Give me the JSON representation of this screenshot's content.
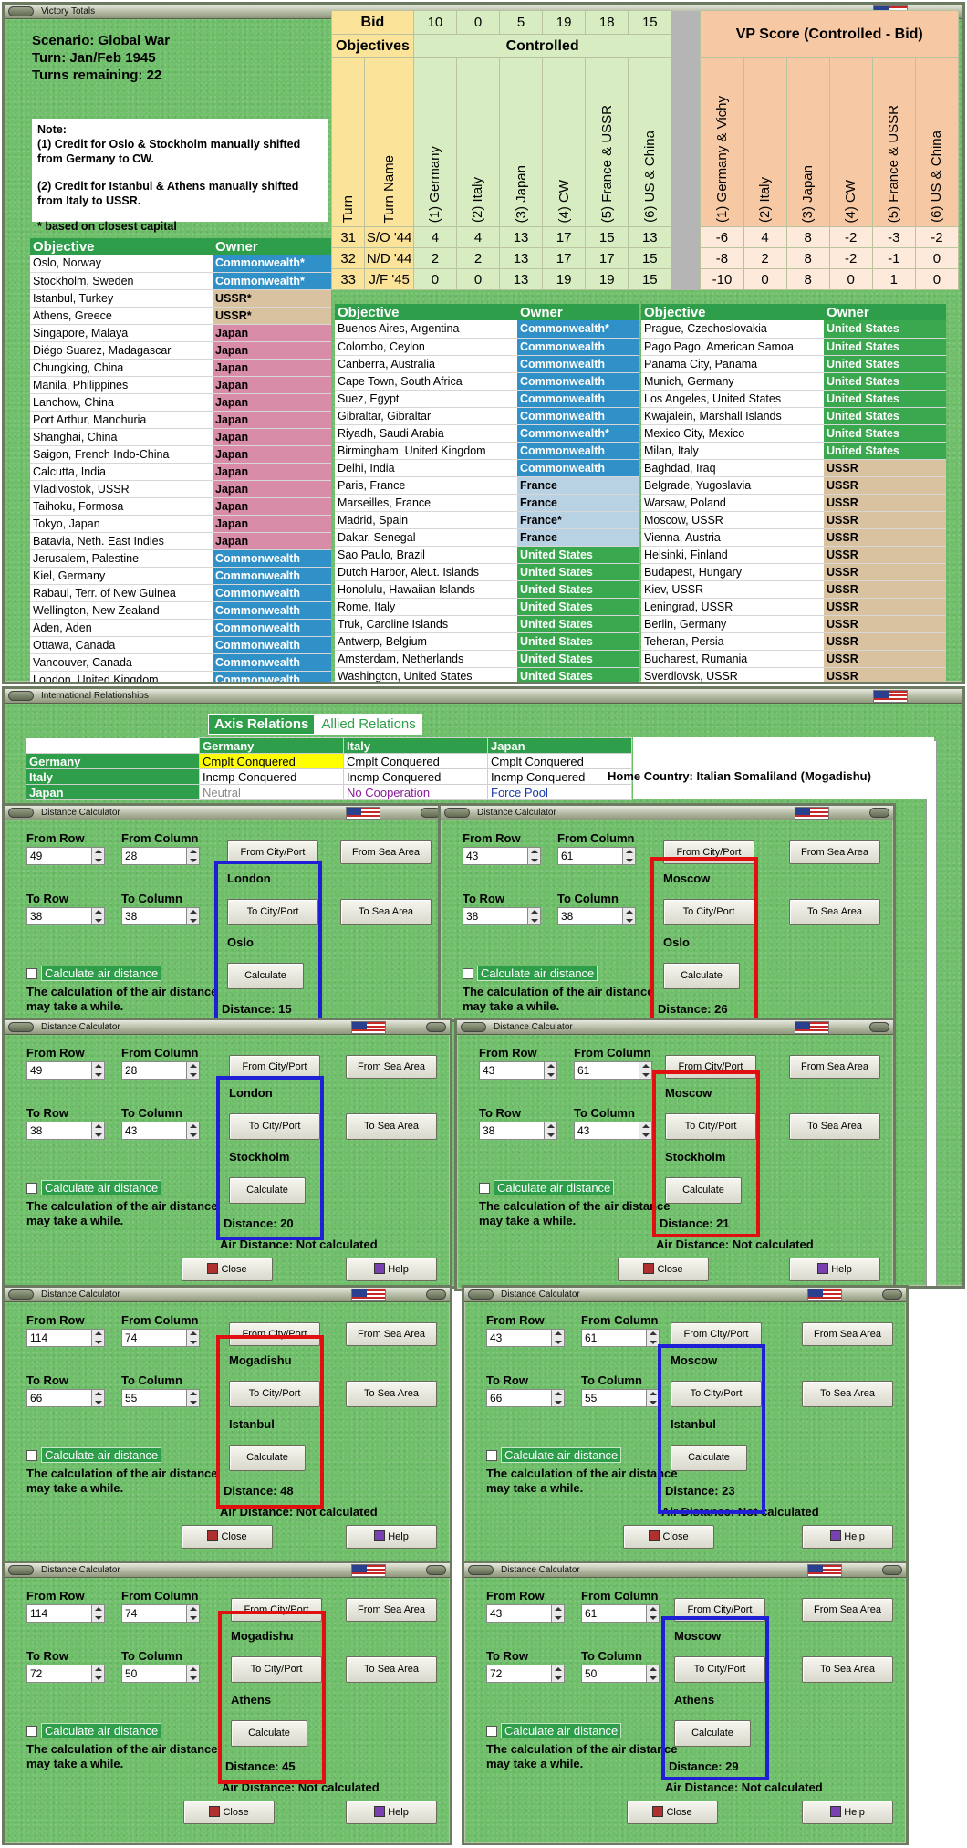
{
  "victory": {
    "title": "Victory Totals",
    "scenario": "Scenario: Global War",
    "turn": "Turn: Jan/Feb 1945",
    "turns_remaining": "Turns remaining: 22",
    "note_title": "Note:",
    "note1": "(1) Credit for Oslo & Stockholm manually shifted from Germany to CW.",
    "note2": "(2) Credit for Istanbul & Athens manually shifted from Italy to USSR.",
    "footnote": "* based on closest capital",
    "header_objective": "Objective",
    "header_owner": "Owner",
    "bid_label": "Bid",
    "bid_values": [
      "10",
      "0",
      "5",
      "19",
      "18",
      "15"
    ],
    "objectives_label": "Objectives",
    "controlled_label": "Controlled",
    "vp_label": "VP Score (Controlled - Bid)",
    "turn_col": "Turn",
    "turnname_col": "Turn Name",
    "powers": [
      "(1) Germany",
      "(2) Italy",
      "(3) Japan",
      "(4) CW",
      "(5) France & USSR",
      "(6) US & China"
    ],
    "vp_powers": [
      "(1) Germany & Vichy",
      "(2) Italy",
      "(3) Japan",
      "(4) CW",
      "(5) France & USSR",
      "(6) US & China"
    ],
    "rows": [
      {
        "turn": "31",
        "name": "S/O '44",
        "controlled": [
          "4",
          "4",
          "13",
          "17",
          "15",
          "13"
        ],
        "vp": [
          "-6",
          "4",
          "8",
          "-2",
          "-3",
          "-2"
        ]
      },
      {
        "turn": "32",
        "name": "N/D '44",
        "controlled": [
          "2",
          "2",
          "13",
          "17",
          "17",
          "15"
        ],
        "vp": [
          "-8",
          "2",
          "8",
          "-2",
          "-1",
          "0"
        ]
      },
      {
        "turn": "33",
        "name": "J/F '45",
        "controlled": [
          "0",
          "0",
          "13",
          "19",
          "19",
          "15"
        ],
        "vp": [
          "-10",
          "0",
          "8",
          "0",
          "1",
          "0"
        ]
      }
    ],
    "col1": [
      {
        "name": "Oslo, Norway",
        "owner": "Commonwealth*",
        "cls": "Commonwealth"
      },
      {
        "name": "Stockholm, Sweden",
        "owner": "Commonwealth*",
        "cls": "Commonwealth"
      },
      {
        "name": "Istanbul, Turkey",
        "owner": "USSR*",
        "cls": "USSR"
      },
      {
        "name": "Athens, Greece",
        "owner": "USSR*",
        "cls": "USSR"
      },
      {
        "name": "Singapore, Malaya",
        "owner": "Japan",
        "cls": "Japan"
      },
      {
        "name": "Diégo Suarez, Madagascar",
        "owner": "Japan",
        "cls": "Japan"
      },
      {
        "name": "Chungking, China",
        "owner": "Japan",
        "cls": "Japan"
      },
      {
        "name": "Manila, Philippines",
        "owner": "Japan",
        "cls": "Japan"
      },
      {
        "name": "Lanchow, China",
        "owner": "Japan",
        "cls": "Japan"
      },
      {
        "name": "Port Arthur, Manchuria",
        "owner": "Japan",
        "cls": "Japan"
      },
      {
        "name": "Shanghai, China",
        "owner": "Japan",
        "cls": "Japan"
      },
      {
        "name": "Saigon, French Indo-China",
        "owner": "Japan",
        "cls": "Japan"
      },
      {
        "name": "Calcutta, India",
        "owner": "Japan",
        "cls": "Japan"
      },
      {
        "name": "Vladivostok, USSR",
        "owner": "Japan",
        "cls": "Japan"
      },
      {
        "name": "Taihoku, Formosa",
        "owner": "Japan",
        "cls": "Japan"
      },
      {
        "name": "Tokyo, Japan",
        "owner": "Japan",
        "cls": "Japan"
      },
      {
        "name": "Batavia, Neth. East Indies",
        "owner": "Japan",
        "cls": "Japan"
      },
      {
        "name": "Jerusalem, Palestine",
        "owner": "Commonwealth",
        "cls": "Commonwealth"
      },
      {
        "name": "Kiel, Germany",
        "owner": "Commonwealth",
        "cls": "Commonwealth"
      },
      {
        "name": "Rabaul, Terr. of New Guinea",
        "owner": "Commonwealth",
        "cls": "Commonwealth"
      },
      {
        "name": "Wellington, New Zealand",
        "owner": "Commonwealth",
        "cls": "Commonwealth"
      },
      {
        "name": "Aden, Aden",
        "owner": "Commonwealth",
        "cls": "Commonwealth"
      },
      {
        "name": "Ottawa, Canada",
        "owner": "Commonwealth",
        "cls": "Commonwealth"
      },
      {
        "name": "Vancouver, Canada",
        "owner": "Commonwealth",
        "cls": "Commonwealth"
      },
      {
        "name": "London, United Kingdom",
        "owner": "Commonwealth",
        "cls": "Commonwealth"
      }
    ],
    "col2": [
      {
        "name": "Buenos Aires, Argentina",
        "owner": "Commonwealth*",
        "cls": "Commonwealth"
      },
      {
        "name": "Colombo, Ceylon",
        "owner": "Commonwealth",
        "cls": "Commonwealth"
      },
      {
        "name": "Canberra, Australia",
        "owner": "Commonwealth",
        "cls": "Commonwealth"
      },
      {
        "name": "Cape Town, South Africa",
        "owner": "Commonwealth",
        "cls": "Commonwealth"
      },
      {
        "name": "Suez, Egypt",
        "owner": "Commonwealth",
        "cls": "Commonwealth"
      },
      {
        "name": "Gibraltar, Gibraltar",
        "owner": "Commonwealth",
        "cls": "Commonwealth"
      },
      {
        "name": "Riyadh, Saudi Arabia",
        "owner": "Commonwealth*",
        "cls": "Commonwealth"
      },
      {
        "name": "Birmingham, United Kingdom",
        "owner": "Commonwealth",
        "cls": "Commonwealth"
      },
      {
        "name": "Delhi, India",
        "owner": "Commonwealth",
        "cls": "Commonwealth"
      },
      {
        "name": "Paris, France",
        "owner": "France",
        "cls": "France"
      },
      {
        "name": "Marseilles, France",
        "owner": "France",
        "cls": "France"
      },
      {
        "name": "Madrid, Spain",
        "owner": "France*",
        "cls": "France"
      },
      {
        "name": "Dakar, Senegal",
        "owner": "France",
        "cls": "France"
      },
      {
        "name": "Sao Paulo, Brazil",
        "owner": "United States",
        "cls": "US"
      },
      {
        "name": "Dutch Harbor, Aleut. Islands",
        "owner": "United States",
        "cls": "US"
      },
      {
        "name": "Honolulu, Hawaiian Islands",
        "owner": "United States",
        "cls": "US"
      },
      {
        "name": "Rome, Italy",
        "owner": "United States",
        "cls": "US"
      },
      {
        "name": "Truk, Caroline Islands",
        "owner": "United States",
        "cls": "US"
      },
      {
        "name": "Antwerp, Belgium",
        "owner": "United States",
        "cls": "US"
      },
      {
        "name": "Amsterdam, Netherlands",
        "owner": "United States",
        "cls": "US"
      },
      {
        "name": "Washington, United States",
        "owner": "United States",
        "cls": "US"
      }
    ],
    "col3": [
      {
        "name": "Prague, Czechoslovakia",
        "owner": "United States",
        "cls": "US"
      },
      {
        "name": "Pago Pago, American Samoa",
        "owner": "United States",
        "cls": "US"
      },
      {
        "name": "Panama City, Panama",
        "owner": "United States",
        "cls": "US"
      },
      {
        "name": "Munich, Germany",
        "owner": "United States",
        "cls": "US"
      },
      {
        "name": "Los Angeles, United States",
        "owner": "United States",
        "cls": "US"
      },
      {
        "name": "Kwajalein, Marshall Islands",
        "owner": "United States",
        "cls": "US"
      },
      {
        "name": "Mexico City, Mexico",
        "owner": "United States",
        "cls": "US"
      },
      {
        "name": "Milan, Italy",
        "owner": "United States",
        "cls": "US"
      },
      {
        "name": "Baghdad, Iraq",
        "owner": "USSR",
        "cls": "USSR"
      },
      {
        "name": "Belgrade, Yugoslavia",
        "owner": "USSR",
        "cls": "USSR"
      },
      {
        "name": "Warsaw, Poland",
        "owner": "USSR",
        "cls": "USSR"
      },
      {
        "name": "Moscow, USSR",
        "owner": "USSR",
        "cls": "USSR"
      },
      {
        "name": "Vienna, Austria",
        "owner": "USSR",
        "cls": "USSR"
      },
      {
        "name": "Helsinki, Finland",
        "owner": "USSR",
        "cls": "USSR"
      },
      {
        "name": "Budapest, Hungary",
        "owner": "USSR",
        "cls": "USSR"
      },
      {
        "name": "Kiev, USSR",
        "owner": "USSR",
        "cls": "USSR"
      },
      {
        "name": "Leningrad, USSR",
        "owner": "USSR",
        "cls": "USSR"
      },
      {
        "name": "Berlin, Germany",
        "owner": "USSR",
        "cls": "USSR"
      },
      {
        "name": "Teheran, Persia",
        "owner": "USSR",
        "cls": "USSR"
      },
      {
        "name": "Bucharest, Rumania",
        "owner": "USSR",
        "cls": "USSR"
      },
      {
        "name": "Sverdlovsk, USSR",
        "owner": "USSR",
        "cls": "USSR"
      }
    ]
  },
  "relations": {
    "title": "International Relationships",
    "tab_axis": "Axis Relations",
    "tab_allied": "Allied Relations",
    "columns": [
      "Germany",
      "Italy",
      "Japan"
    ],
    "rows": [
      {
        "label": "Germany",
        "cells": [
          "Cmplt Conquered",
          "Cmplt Conquered",
          "Cmplt Conquered"
        ]
      },
      {
        "label": "Italy",
        "cells": [
          "Incmp Conquered",
          "Incmp Conquered",
          "Incmp Conquered"
        ]
      },
      {
        "label": "Japan",
        "cells": [
          "Neutral",
          "No Cooperation",
          "Force Pool"
        ]
      }
    ],
    "home_country": "Home Country:  Italian Somaliland (Mogadishu)"
  },
  "calc": {
    "title": "Distance Calculator",
    "from_row": "From Row",
    "from_col": "From Column",
    "to_row": "To Row",
    "to_col": "To Column",
    "from_city": "From City/Port",
    "from_sea": "From Sea Area",
    "to_city": "To City/Port",
    "to_sea": "To Sea Area",
    "calculate": "Calculate",
    "air_checkbox": "Calculate air distance",
    "warning": "The calculation of the air distance may take a while.",
    "close": "Close",
    "help": "Help",
    "air_distance": "Air Distance:  Not calculated",
    "panels": [
      {
        "from_row": "49",
        "from_col": "28",
        "to_row": "38",
        "to_col": "38",
        "from_city": "London",
        "to_city": "Oslo",
        "distance": "Distance:  15",
        "box": "#1f1fd6"
      },
      {
        "from_row": "43",
        "from_col": "61",
        "to_row": "38",
        "to_col": "38",
        "from_city": "Moscow",
        "to_city": "Oslo",
        "distance": "Distance:  26",
        "box": "#e01010"
      },
      {
        "from_row": "49",
        "from_col": "28",
        "to_row": "38",
        "to_col": "43",
        "from_city": "London",
        "to_city": "Stockholm",
        "distance": "Distance:  20",
        "box": "#1f1fd6"
      },
      {
        "from_row": "43",
        "from_col": "61",
        "to_row": "38",
        "to_col": "43",
        "from_city": "Moscow",
        "to_city": "Stockholm",
        "distance": "Distance:  21",
        "box": "#e01010"
      },
      {
        "from_row": "114",
        "from_col": "74",
        "to_row": "66",
        "to_col": "55",
        "from_city": "Mogadishu",
        "to_city": "Istanbul",
        "distance": "Distance:  48",
        "box": "#e01010"
      },
      {
        "from_row": "43",
        "from_col": "61",
        "to_row": "66",
        "to_col": "55",
        "from_city": "Moscow",
        "to_city": "Istanbul",
        "distance": "Distance:  23",
        "box": "#1f1fd6"
      },
      {
        "from_row": "114",
        "from_col": "74",
        "to_row": "72",
        "to_col": "50",
        "from_city": "Mogadishu",
        "to_city": "Athens",
        "distance": "Distance:  45",
        "box": "#e01010"
      },
      {
        "from_row": "43",
        "from_col": "61",
        "to_row": "72",
        "to_col": "50",
        "from_city": "Moscow",
        "to_city": "Athens",
        "distance": "Distance:  29",
        "box": "#1f1fd6"
      }
    ]
  },
  "colors": {
    "green": "#2e9e4a",
    "felt": "#6fbf6a",
    "japan": "#d98ca8",
    "cw": "#3090c8",
    "ussr": "#d8c2a0",
    "france": "#b8d2e4",
    "us": "#3aa84e",
    "bid_yellow": "#fbe49a",
    "controlled_green": "#d7ecc0",
    "vp_orange": "#f6c9a4"
  }
}
